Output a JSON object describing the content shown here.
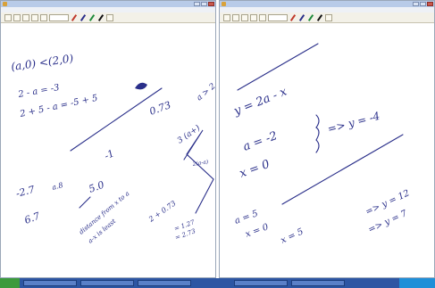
{
  "left_window": {
    "title": "",
    "menu": [],
    "zoom": "",
    "question_number": "",
    "question_text": "",
    "warning_text": "",
    "footer_text": "",
    "page": ""
  },
  "right_window": {
    "title": "",
    "menu": [],
    "zoom": "",
    "question_number": "",
    "question_text": "",
    "warning_text": "",
    "footer_text": "",
    "page": ""
  },
  "handwriting_left": [
    "(a,0) <(2,0)",
    "2 - a = -3",
    "2 + 5 - a = -5 + 5",
    "-1",
    "0.73",
    "a > 2",
    "3 (a+)",
    "2(a-a)",
    "-2.7",
    "a.8",
    "5.0",
    "6.7",
    "distance from x to a",
    "a-x is least",
    "2 + 0.73",
    "= 1.27",
    "= 2.73"
  ],
  "handwriting_right": [
    "y = 2a - x",
    "a = -2",
    "x = 0",
    "=> y = -4",
    "a = 5",
    "x = 0",
    "x = 5",
    "=> y = 12",
    "=> y = 7"
  ],
  "colors": {
    "ink": "#2a2f8a",
    "warning": "#d02020",
    "footer": "#2030b0",
    "titlebar": "#b8cbe8",
    "taskbar": "#2d56a3"
  },
  "taskbar": {
    "start_label": "",
    "tasks": [
      "",
      "",
      "",
      "",
      ""
    ],
    "clock": ""
  }
}
